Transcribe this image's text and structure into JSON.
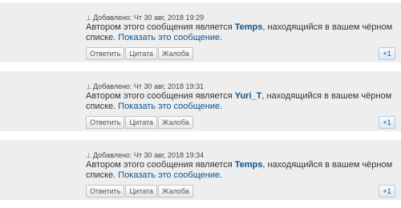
{
  "posts": [
    {
      "header_icon": "profile-icon",
      "header": "Добавлено: Чт 30 авг, 2018 19:29",
      "body_pre": "Автором этого сообщения является ",
      "author": "Temps",
      "body_post": ", находящийся в вашем чёрном списке. ",
      "show_link": "Показать это сообщение.",
      "buttons": {
        "reply": "Ответить",
        "quote": "Цитата",
        "report": "Жалоба"
      },
      "plus": "+1"
    },
    {
      "header_icon": "profile-icon",
      "header": "Добавлено: Чт 30 авг, 2018 19:31",
      "body_pre": "Автором этого сообщения является ",
      "author": "Yuri_T",
      "body_post": ", находящийся в вашем чёрном списке. ",
      "show_link": "Показать это сообщение.",
      "buttons": {
        "reply": "Ответить",
        "quote": "Цитата",
        "report": "Жалоба"
      },
      "plus": "+1"
    },
    {
      "header_icon": "profile-icon",
      "header": "Добавлено: Чт 30 авг, 2018 19:34",
      "body_pre": "Автором этого сообщения является ",
      "author": "Temps",
      "body_post": ", находящийся в вашем чёрном списке. ",
      "show_link": "Показать это сообщение.",
      "buttons": {
        "reply": "Ответить",
        "quote": "Цитата",
        "report": "Жалоба"
      },
      "plus": "+1"
    }
  ],
  "colors": {
    "post_background": "#eeeeee",
    "link": "#105289",
    "text": "#333333"
  }
}
